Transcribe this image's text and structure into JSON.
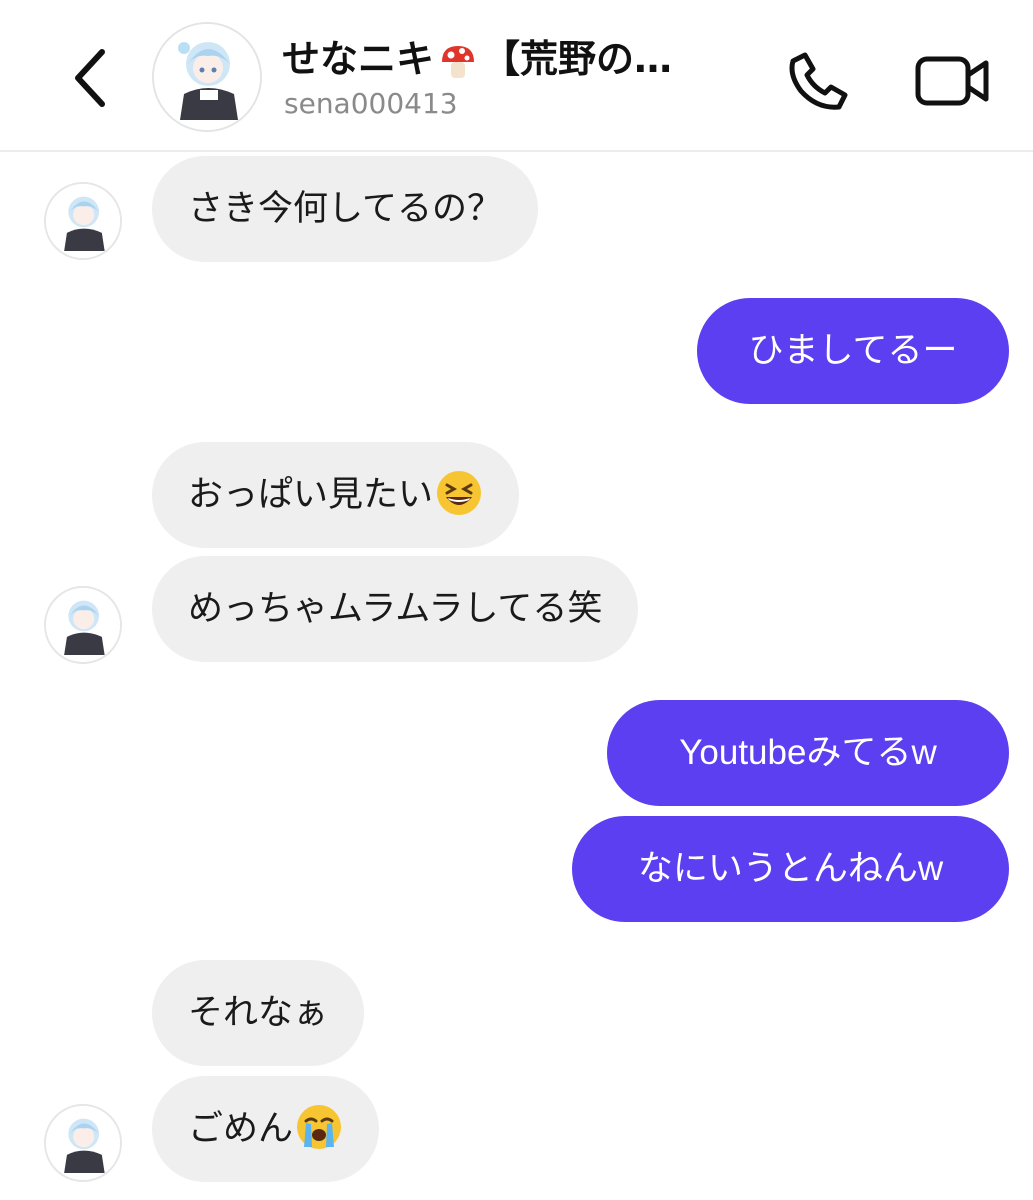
{
  "header": {
    "back_icon": "chevron-left-icon",
    "title_prefix": "せなニキ",
    "title_emoji": "mushroom-emoji",
    "title_suffix": "【荒野の…",
    "username": "sena000413",
    "call_icon": "phone-icon",
    "video_icon": "video-camera-icon"
  },
  "colors": {
    "outgoing_bubble": "#5b3ff0",
    "incoming_bubble": "#efefef",
    "username_gray": "#8a8a8a"
  },
  "messages": [
    {
      "direction": "incoming",
      "text": "さき今何してるの？"
    },
    {
      "direction": "outgoing",
      "text": "ひましてるー"
    },
    {
      "direction": "incoming",
      "text": "おっぱい見たい",
      "emoji": "grinning-squinting-face-emoji"
    },
    {
      "direction": "incoming",
      "text": "めっちゃムラムラしてる笑"
    },
    {
      "direction": "outgoing",
      "text": "Youtubeみてるw"
    },
    {
      "direction": "outgoing",
      "text": "なにいうとんねんw"
    },
    {
      "direction": "incoming",
      "text": "それなぁ"
    },
    {
      "direction": "incoming",
      "text": "ごめん",
      "emoji": "loudly-crying-face-emoji"
    }
  ]
}
